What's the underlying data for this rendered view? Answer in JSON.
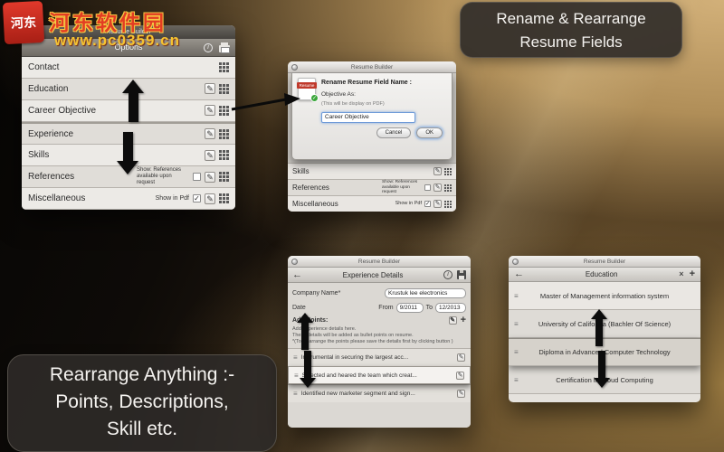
{
  "watermark": {
    "logo_glyph": "河东",
    "site_name": "河东软件园",
    "site_url": "www.pc0359.cn"
  },
  "callouts": {
    "top": {
      "line1": "Rename & Rearrange",
      "line2": "Resume Fields"
    },
    "bottom": {
      "line1": "Rearrange Anything :-",
      "line2": "Points, Descriptions,",
      "line3": "Skill etc."
    }
  },
  "icons": {
    "info": "i",
    "edit": "✎",
    "check": "✓",
    "back": "←",
    "close": "×",
    "plus": "+",
    "handle": "≡"
  },
  "options_window": {
    "title": "Resume Builder",
    "toolbar_title": "Options",
    "rows": [
      {
        "label": "Contact"
      },
      {
        "label": "Education"
      },
      {
        "label": "Career Objective"
      },
      {
        "label": "Experience"
      },
      {
        "label": "Skills"
      },
      {
        "label": "References",
        "note": "Show: References available upon request"
      },
      {
        "label": "Miscellaneous",
        "note": "Show in Pdf"
      }
    ]
  },
  "rename_window": {
    "title": "Resume Builder",
    "dialog": {
      "icon_text": "Resume",
      "heading": "Rename Resume Field Name :",
      "field_label": "Objective As:",
      "hint": "(This will be display on PDF)",
      "input_value": "Career Objective",
      "cancel_label": "Cancel",
      "ok_label": "OK"
    },
    "rows": [
      {
        "label": "Skills"
      },
      {
        "label": "References",
        "note": "Show: References available upon request"
      },
      {
        "label": "Miscellaneous",
        "note": "Show in Pdf"
      }
    ]
  },
  "experience_window": {
    "title": "Resume Builder",
    "subtitle": "Experience Details",
    "company_label": "Company Name*",
    "company_value": "Krustuk lee electronics",
    "date_label": "Date",
    "from_label": "From",
    "from_value": "9/2011",
    "to_label": "To",
    "to_value": "12/2013",
    "add_points_label": "Add Points:",
    "help_lines": [
      "Add Experience details here.",
      "These details will be added as bullet points on resume.",
      "*(To Rearrange the points please save the details first by clicking button )"
    ],
    "points": [
      "Instrumental in securing the largest acc...",
      "Selected and heared the team which creat...",
      "Identified new marketer segment and sign..."
    ]
  },
  "education_window": {
    "title": "Resume Builder",
    "subtitle": "Education",
    "rows": [
      "Master of Management information system",
      "University of California (Bachler Of Science)",
      "Diploma in Advanced Computer Technology",
      "Certification in Cloud Computing"
    ]
  }
}
